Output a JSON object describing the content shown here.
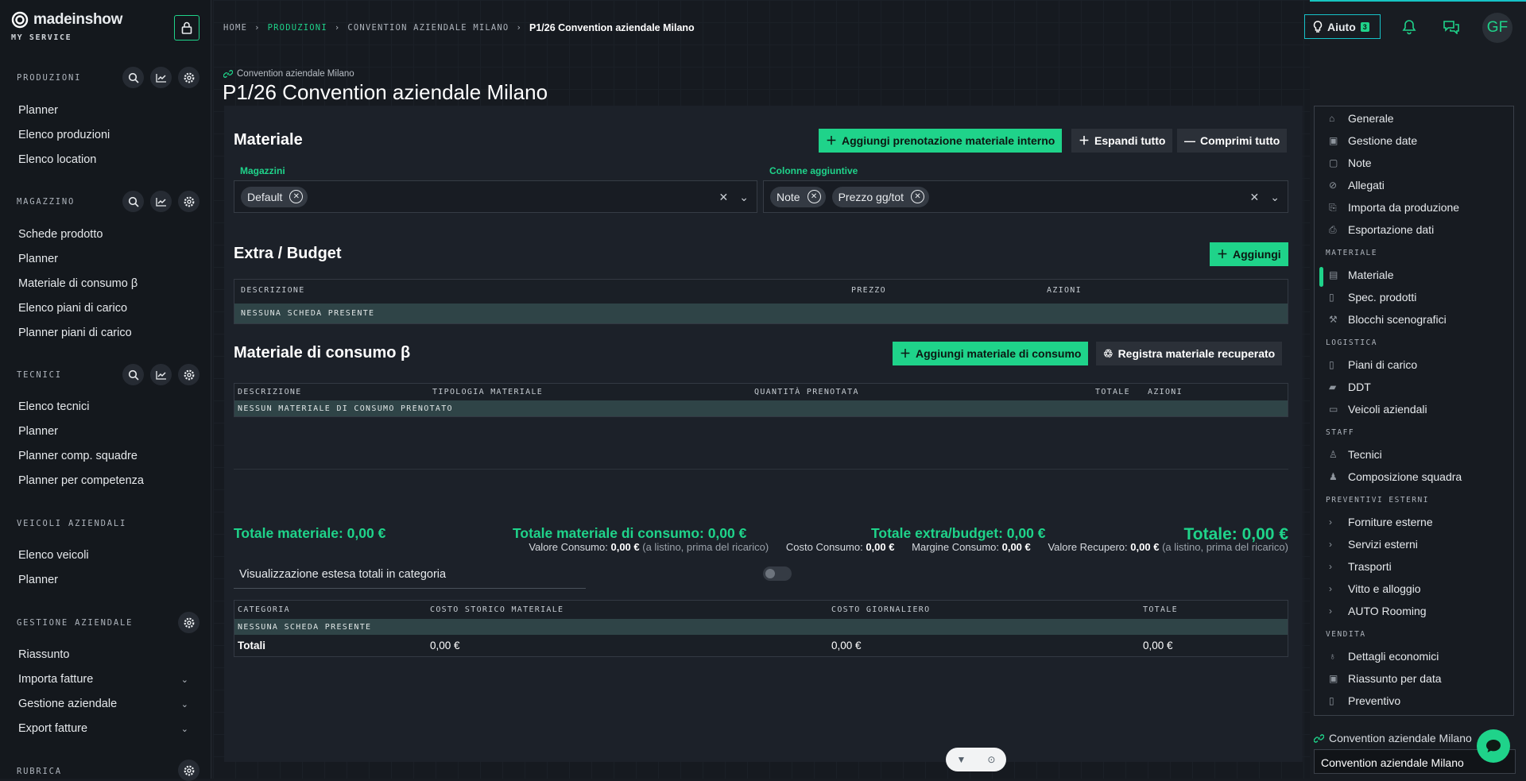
{
  "brand": {
    "name": "madeinshow",
    "sub": "MY SERVICE"
  },
  "sidebar": {
    "sections": [
      {
        "title": "PRODUZIONI",
        "items": [
          "Planner",
          "Elenco produzioni",
          "Elenco location"
        ]
      },
      {
        "title": "MAGAZZINO",
        "items": [
          "Schede prodotto",
          "Planner",
          "Materiale di consumo β",
          "Elenco piani di carico",
          "Planner piani di carico"
        ]
      },
      {
        "title": "TECNICI",
        "items": [
          "Elenco tecnici",
          "Planner",
          "Planner comp. squadre",
          "Planner per competenza"
        ]
      },
      {
        "title": "VEICOLI AZIENDALI",
        "items": [
          "Elenco veicoli",
          "Planner"
        ]
      },
      {
        "title": "GESTIONE AZIENDALE",
        "items": [
          "Riassunto",
          "Importa fatture",
          "Gestione aziendale",
          "Export fatture"
        ]
      },
      {
        "title": "RUBRICA",
        "items": []
      }
    ]
  },
  "breadcrumb": {
    "home": "HOME",
    "produzioni": "PRODUZIONI",
    "convention": "CONVENTION AZIENDALE MILANO",
    "current": "P1/26 Convention aziendale Milano"
  },
  "header": {
    "help_label": "Aiuto",
    "help_count": "3",
    "avatar": "GF"
  },
  "page": {
    "pretitle": "Convention aziendale Milano",
    "title": "P1/26 Convention aziendale Milano"
  },
  "materiale": {
    "title": "Materiale",
    "btn_add_internal": "Aggiungi prenotazione materiale interno",
    "btn_expand": "Espandi tutto",
    "btn_collapse": "Comprimi tutto",
    "magazzini_label": "Magazzini",
    "magazzini_chips": [
      "Default"
    ],
    "colonne_label": "Colonne aggiuntive",
    "colonne_chips": [
      "Note",
      "Prezzo gg/tot"
    ]
  },
  "extra": {
    "title": "Extra / Budget",
    "btn_add": "Aggiungi",
    "headers": [
      "DESCRIZIONE",
      "PREZZO",
      "AZIONI"
    ],
    "empty": "NESSUNA SCHEDA PRESENTE"
  },
  "consumo": {
    "title": "Materiale di consumo β",
    "btn_add": "Aggiungi materiale di consumo",
    "btn_recover": "Registra materiale recuperato",
    "headers": [
      "DESCRIZIONE",
      "TIPOLOGIA MATERIALE",
      "QUANTITÀ PRENOTATA",
      "TOTALE",
      "AZIONI"
    ],
    "empty": "NESSUN MATERIALE DI CONSUMO PRENOTATO",
    "valore_label": "Valore Consumo:",
    "valore": "0,00 €",
    "valore_note": "(a listino, prima del ricarico)",
    "costo_label": "Costo Consumo:",
    "costo": "0,00 €",
    "margine_label": "Margine Consumo:",
    "margine": "0,00 €",
    "recupero_label": "Valore Recupero:",
    "recupero": "0,00 €",
    "recupero_note": "(a listino, prima del ricarico)"
  },
  "totali": {
    "materiale": "Totale materiale: 0,00 €",
    "consumo": "Totale materiale di consumo: 0,00 €",
    "extra": "Totale extra/budget: 0,00 €",
    "totale": "Totale: 0,00 €",
    "toggle_label": "Visualizzazione estesa totali in categoria",
    "toggle_on": false,
    "headers": [
      "CATEGORIA",
      "COSTO STORICO MATERIALE",
      "COSTO GIORNALIERO",
      "TOTALE"
    ],
    "empty": "NESSUNA SCHEDA PRESENTE",
    "row": [
      "Totali",
      "0,00 €",
      "0,00 €",
      "0,00 €"
    ]
  },
  "rightnav": {
    "top": [
      "Generale",
      "Gestione date",
      "Note",
      "Allegati",
      "Importa da produzione",
      "Esportazione dati"
    ],
    "sec_materiale": "MATERIALE",
    "materiale": [
      "Materiale",
      "Spec. prodotti",
      "Blocchi scenografici"
    ],
    "sec_logistica": "LOGISTICA",
    "logistica": [
      "Piani di carico",
      "DDT",
      "Veicoli aziendali"
    ],
    "sec_staff": "STAFF",
    "staff": [
      "Tecnici",
      "Composizione squadra"
    ],
    "sec_preventivi": "PREVENTIVI ESTERNI",
    "preventivi": [
      "Forniture esterne",
      "Servizi esterni",
      "Trasporti",
      "Vitto e alloggio",
      "AUTO Rooming"
    ],
    "sec_vendita": "VENDITA",
    "vendita": [
      "Dettagli economici",
      "Riassunto per data",
      "Preventivo"
    ],
    "active": "Materiale"
  },
  "footer": {
    "link": "Convention aziendale Milano",
    "select": "Convention aziendale Milano"
  },
  "colors": {
    "accent": "#1fd38a",
    "teal": "#16c2c9",
    "bg": "#181c22"
  }
}
